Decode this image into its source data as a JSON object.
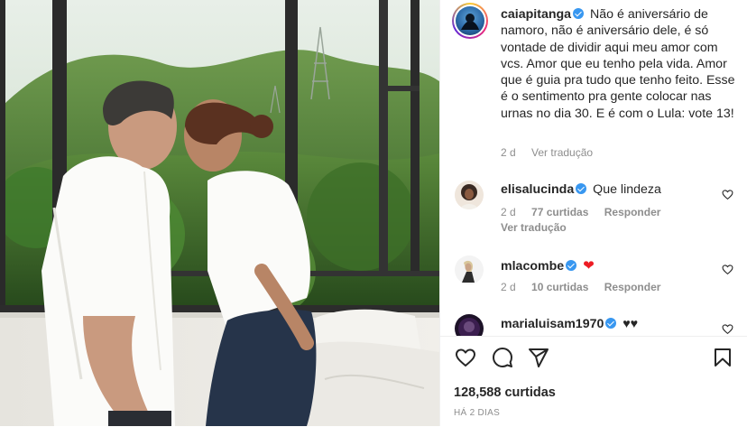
{
  "post": {
    "image_alt": "Casal se beijando diante de uma janela com vista para a mata",
    "author": {
      "username": "caiapitanga",
      "verified": true
    },
    "caption": "Não é aniversário de namoro, não é aniversário dele, é só vontade de dividir aqui meu amor com vcs. Amor que eu tenho pela vida. Amor que é guia pra tudo que tenho feito. Esse é o sentimento pra gente colocar nas urnas no dia 30. E é com o Lula: vote 13!",
    "caption_meta": {
      "time": "2 d",
      "translate": "Ver tradução"
    },
    "comments": [
      {
        "username": "elisalucinda",
        "text": "Que lindeza",
        "time": "2 d",
        "likes": "77 curtidas",
        "reply": "Responder",
        "translate": "Ver tradução"
      },
      {
        "username": "mlacombe",
        "text": "",
        "emoji": "❤",
        "time": "2 d",
        "likes": "10 curtidas",
        "reply": "Responder"
      },
      {
        "username": "marialuisam1970",
        "text": "♥♥"
      }
    ],
    "likes_count": "128,588 curtidas",
    "posted_ago": "HÁ 2 DIAS"
  },
  "icons": {
    "like": "heart-outline-icon",
    "comment": "speech-bubble-icon",
    "share": "paper-plane-icon",
    "save": "bookmark-icon",
    "verified": "verified-badge-icon"
  },
  "colors": {
    "verified": "#3897f0",
    "emoji_heart": "#ed1c24",
    "muted_text": "#8e8e8e"
  }
}
